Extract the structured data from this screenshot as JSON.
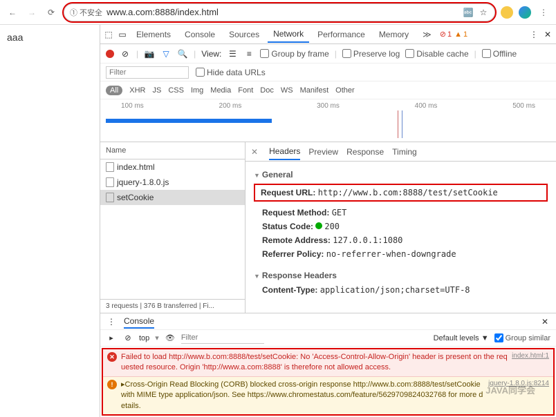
{
  "browser": {
    "security_badge": "① 不安全",
    "url": "www.a.com:8888/index.html"
  },
  "page": {
    "content": "aaa"
  },
  "devtools": {
    "tabs": [
      "Elements",
      "Console",
      "Sources",
      "Network",
      "Performance",
      "Memory"
    ],
    "more": "≫",
    "errors": "1",
    "warnings": "1",
    "controls": {
      "view": "View:",
      "group_by_frame": "Group by frame",
      "preserve_log": "Preserve log",
      "disable_cache": "Disable cache",
      "offline": "Offline"
    },
    "filter": {
      "placeholder": "Filter",
      "hide_data": "Hide data URLs"
    },
    "types": {
      "all": "All",
      "items": [
        "XHR",
        "JS",
        "CSS",
        "Img",
        "Media",
        "Font",
        "Doc",
        "WS",
        "Manifest",
        "Other"
      ]
    },
    "timeline": {
      "ticks": [
        "100 ms",
        "200 ms",
        "300 ms",
        "400 ms",
        "500 ms"
      ]
    },
    "requests": {
      "header": "Name",
      "items": [
        "index.html",
        "jquery-1.8.0.js",
        "setCookie"
      ],
      "status": "3 requests | 376 B transferred | Fi..."
    },
    "detail": {
      "tabs": [
        "Headers",
        "Preview",
        "Response",
        "Timing"
      ],
      "general": {
        "label": "General",
        "request_url_label": "Request URL:",
        "request_url": "http://www.b.com:8888/test/setCookie",
        "method_label": "Request Method:",
        "method": "GET",
        "status_label": "Status Code:",
        "status": "200",
        "remote_label": "Remote Address:",
        "remote": "127.0.0.1:1080",
        "referrer_label": "Referrer Policy:",
        "referrer": "no-referrer-when-downgrade"
      },
      "response_headers": {
        "label": "Response Headers",
        "content_type_label": "Content-Type:",
        "content_type": "application/json;charset=UTF-8"
      }
    },
    "console": {
      "tab": "Console",
      "context": "top",
      "filter": "Filter",
      "levels": "Default levels ▼",
      "group_similar": "Group similar",
      "msgs": {
        "err": "Failed to load http://www.b.com:8888/test/setCookie: No 'Access-Control-Allow-Origin' header is present on the requested resource. Origin 'http://www.a.com:8888' is therefore not allowed access.",
        "err_src": "index.html:1",
        "warn": "▸Cross-Origin Read Blocking (CORB) blocked cross-origin response http://www.b.com:8888/test/setCookie with MIME type application/json. See https://www.chromestatus.com/feature/5629709824032768 for more details.",
        "warn_src": "jquery-1.8.0.js:8214"
      }
    }
  },
  "watermark": "JAVA同学会"
}
